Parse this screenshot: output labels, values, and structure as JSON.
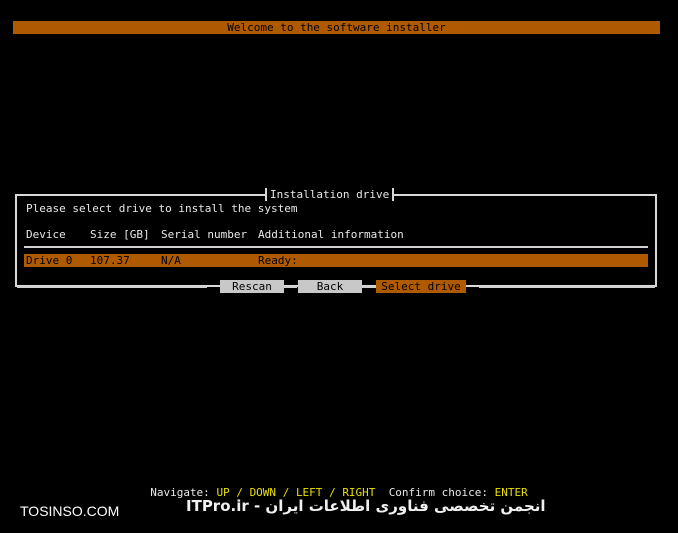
{
  "window": {
    "title": "Welcome to the software installer"
  },
  "dialog": {
    "title": "Installation drive",
    "prompt": "Please select drive to install the system",
    "columns": [
      "Device",
      "Size [GB]",
      "Serial number",
      "Additional information"
    ],
    "rows": [
      {
        "device": "Drive 0",
        "size": "107.37",
        "serial": "N/A",
        "info": "Ready:"
      }
    ]
  },
  "buttons": {
    "rescan": "Rescan",
    "back": "Back",
    "select": "Select drive"
  },
  "footer": {
    "navigate_label": "Navigate:",
    "up": "UP",
    "slash1": "/",
    "down": "DOWN",
    "slash2": "/",
    "left": "LEFT",
    "slash3": "/",
    "right": "RIGHT",
    "confirm_label": "Confirm choice:",
    "enter": "ENTER"
  },
  "watermark": {
    "site": "TOSINSO.COM",
    "itpro": "ITPro.ir - انجمن تخصصی فناوری اطلاعات ایران"
  },
  "colors": {
    "accent": "#b05a00",
    "key": "#e8e000",
    "button": "#c8c8c8"
  }
}
